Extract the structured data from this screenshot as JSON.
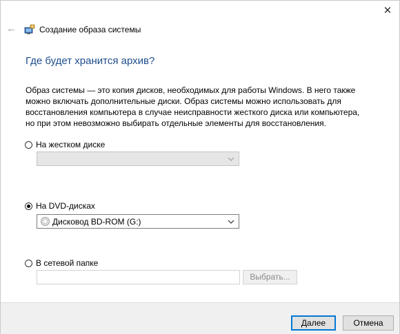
{
  "window": {
    "title": "Создание образа системы",
    "close_glyph": "✕",
    "back_glyph": "←"
  },
  "page": {
    "heading": "Где будет хранится архив?",
    "description": "Образ системы — это копия дисков, необходимых для работы Windows. В него также можно включать дополнительные диски. Образ системы можно использовать для восстановления компьютера в случае неисправности жесткого диска или компьютера, но при этом невозможно выбирать отдельные элементы для восстановления."
  },
  "options": {
    "hard_disk": {
      "label": "На жестком диске",
      "selected": false,
      "value": ""
    },
    "dvd": {
      "label": "На DVD-дисках",
      "selected": true,
      "value": "Дисковод BD-ROM (G:)"
    },
    "network": {
      "label": "В сетевой папке",
      "selected": false,
      "path": "",
      "browse_label": "Выбрать..."
    }
  },
  "footer": {
    "next_label": "Далее",
    "cancel_label": "Отмена"
  },
  "icons": {
    "back": "back-arrow-icon",
    "title": "backup-icon",
    "close": "close-icon",
    "disc": "disc-icon",
    "chevron": "chevron-down-icon"
  },
  "colors": {
    "heading": "#1e4e8c",
    "primary_border": "#0078d7"
  }
}
